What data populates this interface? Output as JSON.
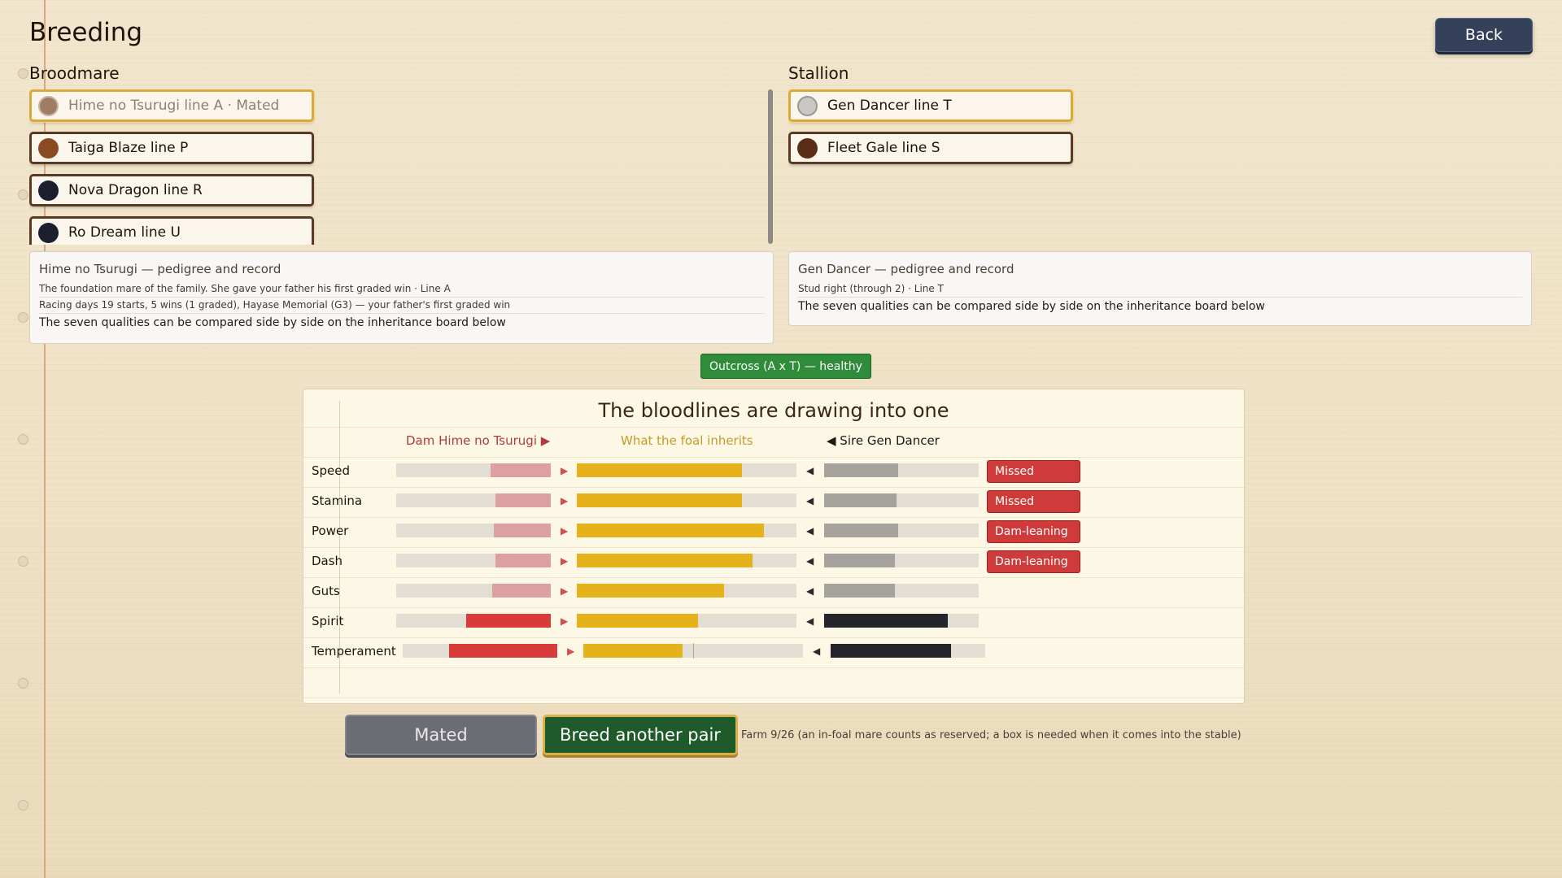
{
  "page": {
    "title": "Breeding",
    "back_label": "Back"
  },
  "broodmare": {
    "label": "Broodmare",
    "items": [
      {
        "label": "Hime no Tsurugi  line A · Mated",
        "color": "#a07c64",
        "selected": true,
        "mated": true
      },
      {
        "label": "Taiga Blaze  line P",
        "color": "#8a4a22"
      },
      {
        "label": "Nova Dragon  line R",
        "color": "#1c1f2e"
      },
      {
        "label": "Ro Dream  line U",
        "color": "#1c1f2e"
      }
    ]
  },
  "stallion": {
    "label": "Stallion",
    "items": [
      {
        "label": "Gen Dancer  line T",
        "color": "#c9c7c4",
        "selected": true
      },
      {
        "label": "Fleet Gale  line S",
        "color": "#5a2e16"
      }
    ]
  },
  "dam_pedigree": {
    "heading": "Hime no Tsurugi  —  pedigree and record",
    "line1": "The foundation mare of the family. She gave your father his first graded win · Line A",
    "line2": "Racing days 19 starts, 5 wins (1 graded), Hayase Memorial (G3) — your father's first graded win",
    "line3": "The seven qualities can be compared side by side on the inheritance board below"
  },
  "sire_pedigree": {
    "heading": "Gen Dancer  —  pedigree and record",
    "line1": "Stud right (through 2) · Line T",
    "line2": "The seven qualities can be compared side by side on the inheritance board below"
  },
  "outcross_badge": "Outcross (A x T) — healthy",
  "board": {
    "title": "The bloodlines are drawing into one",
    "dam_head": "Dam Hime no Tsurugi  ▶",
    "foal_head": "What the foal inherits",
    "sire_head": "◀  Sire Gen Dancer",
    "stats": [
      {
        "name": "Speed",
        "dam": 0.39,
        "dam_strong": false,
        "foal": 0.75,
        "sire": 0.48,
        "sire_strong": false,
        "tag": "Missed"
      },
      {
        "name": "Stamina",
        "dam": 0.36,
        "dam_strong": false,
        "foal": 0.75,
        "sire": 0.47,
        "sire_strong": false,
        "tag": "Missed"
      },
      {
        "name": "Power",
        "dam": 0.37,
        "dam_strong": false,
        "foal": 0.85,
        "sire": 0.48,
        "sire_strong": false,
        "tag": "Dam-leaning"
      },
      {
        "name": "Dash",
        "dam": 0.36,
        "dam_strong": false,
        "foal": 0.8,
        "sire": 0.46,
        "sire_strong": false,
        "tag": "Dam-leaning"
      },
      {
        "name": "Guts",
        "dam": 0.38,
        "dam_strong": false,
        "foal": 0.67,
        "sire": 0.46,
        "sire_strong": false,
        "tag": ""
      },
      {
        "name": "Spirit",
        "dam": 0.55,
        "dam_strong": true,
        "foal": 0.55,
        "sire": 0.8,
        "sire_strong": true,
        "tag": ""
      },
      {
        "name": "Temperament",
        "dam": 0.7,
        "dam_strong": true,
        "foal": 0.45,
        "foal_mark": 0.5,
        "sire": 0.78,
        "sire_strong": true,
        "tag": ""
      }
    ],
    "colors": {
      "dam_weak": "#dda0a0",
      "dam_strong": "#d93a3a",
      "foal": "#e6b21c",
      "sire_weak": "#a6a39e",
      "sire_strong": "#24252b"
    }
  },
  "actions": {
    "mated_label": "Mated",
    "breed_label": "Breed another pair",
    "farm_note": "Farm 9/26 (an in-foal mare counts as reserved; a box is needed when it comes into the stable)"
  }
}
